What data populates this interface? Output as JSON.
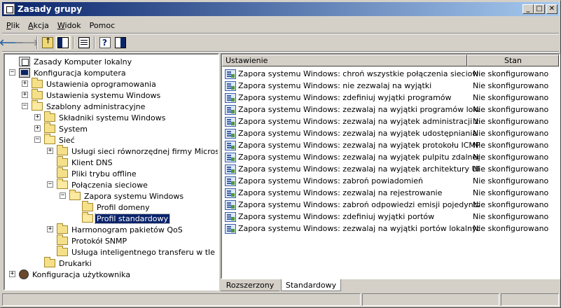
{
  "window": {
    "title": "Zasady grupy",
    "controls": [
      "_",
      "□",
      "✕"
    ]
  },
  "menu": [
    {
      "label": "Plik",
      "accel": "P",
      "rest": "lik"
    },
    {
      "label": "Akcja",
      "accel": "A",
      "rest": "kcja"
    },
    {
      "label": "Widok",
      "accel": "W",
      "rest": "idok"
    },
    {
      "label": "Pomoc",
      "accel": "",
      "rest": "Pomoc"
    }
  ],
  "toolbar": {
    "icons": [
      "back-arrow-icon",
      "forward-arrow-icon",
      "up-folder-icon",
      "show-hide-tree-icon",
      "export-list-icon",
      "help-icon",
      "show-hide-action-pane-icon"
    ],
    "back": "🡐",
    "forward": "🡒"
  },
  "tree": [
    {
      "label": "Zasady Komputer lokalny",
      "level": 0,
      "expander": "",
      "icon": "policy"
    },
    {
      "label": "Konfiguracja komputera",
      "level": 0,
      "expander": "−",
      "icon": "computer"
    },
    {
      "label": "Ustawienia oprogramowania",
      "level": 1,
      "expander": "+",
      "icon": "folder"
    },
    {
      "label": "Ustawienia systemu Windows",
      "level": 1,
      "expander": "+",
      "icon": "folder"
    },
    {
      "label": "Szablony administracyjne",
      "level": 1,
      "expander": "−",
      "icon": "folder-open"
    },
    {
      "label": "Składniki systemu Windows",
      "level": 2,
      "expander": "+",
      "icon": "folder"
    },
    {
      "label": "System",
      "level": 2,
      "expander": "+",
      "icon": "folder"
    },
    {
      "label": "Sieć",
      "level": 2,
      "expander": "−",
      "icon": "folder-open"
    },
    {
      "label": "Usługi sieci równorzędnej firmy Microsoft",
      "level": 3,
      "expander": "+",
      "icon": "folder"
    },
    {
      "label": "Klient DNS",
      "level": 3,
      "expander": "",
      "icon": "folder"
    },
    {
      "label": "Pliki trybu offline",
      "level": 3,
      "expander": "",
      "icon": "folder"
    },
    {
      "label": "Połączenia sieciowe",
      "level": 3,
      "expander": "−",
      "icon": "folder-open"
    },
    {
      "label": "Zapora systemu Windows",
      "level": 4,
      "expander": "−",
      "icon": "folder-open"
    },
    {
      "label": "Profil domeny",
      "level": 5,
      "expander": "",
      "icon": "folder"
    },
    {
      "label": "Profil standardowy",
      "level": 5,
      "expander": "",
      "icon": "folder-open",
      "selected": true
    },
    {
      "label": "Harmonogram pakietów QoS",
      "level": 3,
      "expander": "+",
      "icon": "folder"
    },
    {
      "label": "Protokół SNMP",
      "level": 3,
      "expander": "",
      "icon": "folder"
    },
    {
      "label": "Usługa inteligentnego transferu w tle",
      "level": 3,
      "expander": "",
      "icon": "folder"
    },
    {
      "label": "Drukarki",
      "level": 2,
      "expander": "",
      "icon": "folder"
    },
    {
      "label": "Konfiguracja użytkownika",
      "level": 0,
      "expander": "+",
      "icon": "user"
    }
  ],
  "list": {
    "columns": [
      "Ustawienie",
      "Stan"
    ],
    "rows": [
      {
        "name": "Zapora systemu Windows: chroń wszystkie połączenia sieciowe",
        "state": "Nie skonfigurowano"
      },
      {
        "name": "Zapora systemu Windows: nie zezwalaj na wyjątki",
        "state": "Nie skonfigurowano"
      },
      {
        "name": "Zapora systemu Windows: zdefiniuj wyjątki programów",
        "state": "Nie skonfigurowano"
      },
      {
        "name": "Zapora systemu Windows: zezwalaj na wyjątki programów lokaln...",
        "state": "Nie skonfigurowano"
      },
      {
        "name": "Zapora systemu Windows: zezwalaj na wyjątek administracji zdalnej",
        "state": "Nie skonfigurowano"
      },
      {
        "name": "Zapora systemu Windows: zezwalaj na wyjątek udostępniania pli...",
        "state": "Nie skonfigurowano"
      },
      {
        "name": "Zapora systemu Windows: zezwalaj na wyjątek protokołu ICMP",
        "state": "Nie skonfigurowano"
      },
      {
        "name": "Zapora systemu Windows: zezwalaj na wyjątek pulpitu zdalnego",
        "state": "Nie skonfigurowano"
      },
      {
        "name": "Zapora systemu Windows: zezwalaj na wyjątek architektury UPnP",
        "state": "Nie skonfigurowano"
      },
      {
        "name": "Zapora systemu Windows: zabroń powiadomień",
        "state": "Nie skonfigurowano"
      },
      {
        "name": "Zapora systemu Windows: zezwalaj na rejestrowanie",
        "state": "Nie skonfigurowano"
      },
      {
        "name": "Zapora systemu Windows: zabroń odpowiedzi emisji pojedynczej ...",
        "state": "Nie skonfigurowano"
      },
      {
        "name": "Zapora systemu Windows: zdefiniuj wyjątki portów",
        "state": "Nie skonfigurowano"
      },
      {
        "name": "Zapora systemu Windows: zezwalaj na wyjątki portów lokalnych",
        "state": "Nie skonfigurowano"
      }
    ]
  },
  "tabs": [
    {
      "label": "Rozszerzony",
      "active": false
    },
    {
      "label": "Standardowy",
      "active": true
    }
  ],
  "colors": {
    "title_start": "#0a246a",
    "title_end": "#a6caf0",
    "selection": "#0a246a",
    "face": "#d4d0c8"
  }
}
